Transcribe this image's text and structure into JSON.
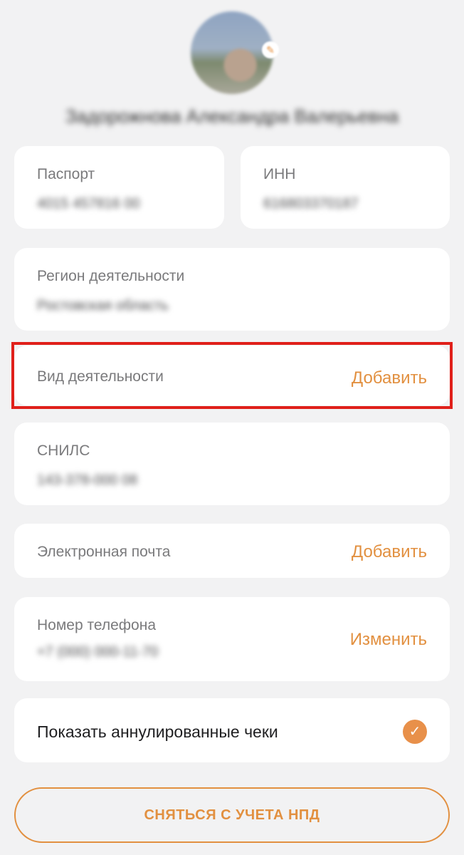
{
  "profile": {
    "avatar_badge_icon": "edit-icon",
    "name": "Задорожнова Александра Валерьевна"
  },
  "passport": {
    "label": "Паспорт",
    "value": "4015 457816 00"
  },
  "inn": {
    "label": "ИНН",
    "value": "616803370187"
  },
  "region": {
    "label": "Регион деятельности",
    "value": "Ростовская область"
  },
  "activity": {
    "label": "Вид деятельности",
    "action": "Добавить"
  },
  "snils": {
    "label": "СНИЛС",
    "value": "143-378-000 08"
  },
  "email": {
    "label": "Электронная почта",
    "action": "Добавить"
  },
  "phone": {
    "label": "Номер телефона",
    "value": "+7 (000) 000-11-70",
    "action": "Изменить"
  },
  "show_cancelled": {
    "label": "Показать аннулированные чеки",
    "checked": true,
    "icon": "check-icon"
  },
  "deregister_button": "СНЯТЬСЯ С УЧЕТА НПД",
  "colors": {
    "accent": "#e29040",
    "highlight": "#e0201a",
    "background": "#f2f2f3",
    "card": "#ffffff"
  }
}
